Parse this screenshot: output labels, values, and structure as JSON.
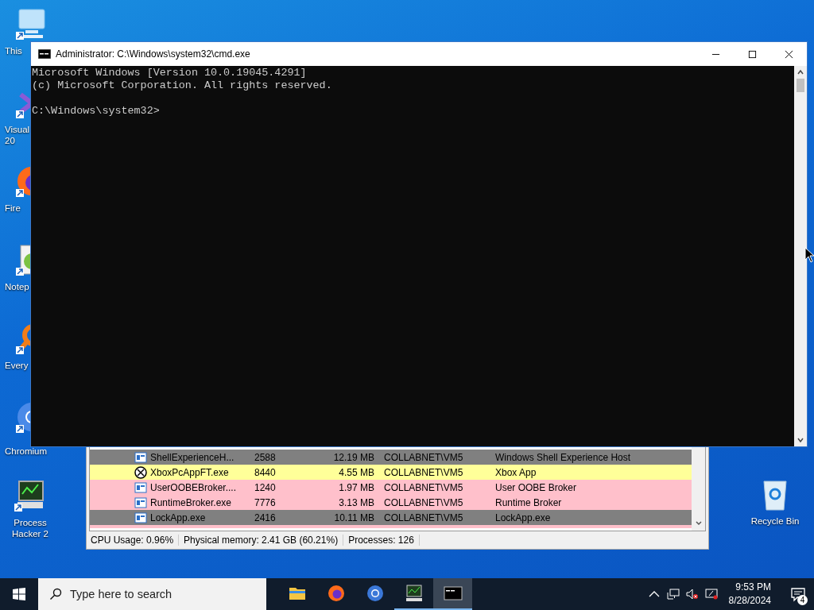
{
  "desktop_icons": [
    {
      "kind": "computer",
      "label": [
        "This"
      ]
    },
    {
      "kind": "visual-studio",
      "label": [
        "Visual",
        "20"
      ]
    },
    {
      "kind": "firefox",
      "label": [
        "Fire"
      ]
    },
    {
      "kind": "notepad",
      "label": [
        "Notep"
      ]
    },
    {
      "kind": "everything",
      "label": [
        "Every"
      ]
    },
    {
      "kind": "chromium",
      "label": [
        "Chromium"
      ]
    },
    {
      "kind": "process-hacker",
      "label": [
        "Process",
        "Hacker 2"
      ]
    }
  ],
  "recycle_bin": {
    "kind": "recycle-bin",
    "label": [
      "Recycle Bin"
    ]
  },
  "cmd_window": {
    "title": "Administrator: C:\\Windows\\system32\\cmd.exe",
    "output": [
      "Microsoft Windows [Version 10.0.19045.4291]",
      "(c) Microsoft Corporation. All rights reserved."
    ],
    "prompt": "C:\\Windows\\system32>"
  },
  "process_hacker": {
    "rows": [
      {
        "kind": "window",
        "process": "ShellExperienceH...",
        "pid": "2588",
        "memory": "12.19 MB",
        "user": "COLLABNET\\VM5",
        "description": "Windows Shell Experience Host",
        "color": "#808080"
      },
      {
        "kind": "xbox",
        "process": "XboxPcAppFT.exe",
        "pid": "8440",
        "memory": "4.55 MB",
        "user": "COLLABNET\\VM5",
        "description": "Xbox App",
        "color": "#ffff99"
      },
      {
        "kind": "window",
        "process": "UserOOBEBroker....",
        "pid": "1240",
        "memory": "1.97 MB",
        "user": "COLLABNET\\VM5",
        "description": "User OOBE Broker",
        "color": "#ffc0cb"
      },
      {
        "kind": "window",
        "process": "RuntimeBroker.exe",
        "pid": "7776",
        "memory": "3.13 MB",
        "user": "COLLABNET\\VM5",
        "description": "Runtime Broker",
        "color": "#ffc0cb"
      },
      {
        "kind": "window",
        "process": "LockApp.exe",
        "pid": "2416",
        "memory": "10.11 MB",
        "user": "COLLABNET\\VM5",
        "description": "LockApp.exe",
        "color": "#808080"
      },
      {
        "kind": "cut",
        "color": "#ffc0cb"
      }
    ],
    "status_bar": [
      "CPU Usage: 0.96%",
      "Physical memory: 2.41 GB (60.21%)",
      "Processes: 126"
    ]
  },
  "taskbar": {
    "search": {
      "placeholder": "Type here to search"
    },
    "apps": [
      {
        "kind": "file-explorer",
        "running": false,
        "selected": false
      },
      {
        "kind": "firefox",
        "running": false,
        "selected": false
      },
      {
        "kind": "chromium",
        "running": false,
        "selected": false
      },
      {
        "kind": "process-hacker",
        "running": true,
        "selected": false
      },
      {
        "kind": "cmd",
        "running": true,
        "selected": true
      }
    ],
    "time": "9:53 PM",
    "date": "8/28/2024",
    "notifications": "4"
  }
}
